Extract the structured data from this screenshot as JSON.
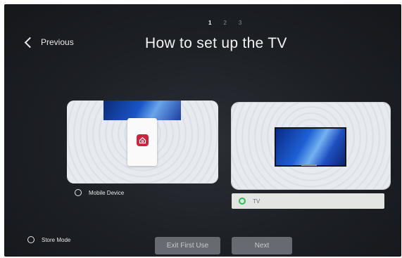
{
  "steps": [
    "1",
    "2",
    "3"
  ],
  "header": {
    "previous_label": "Previous",
    "title": "How to set up the TV"
  },
  "options": {
    "mobile": {
      "label": "Mobile Device"
    },
    "tv": {
      "label": "TV"
    },
    "store_mode": {
      "label": "Store Mode"
    }
  },
  "buttons": {
    "exit": "Exit First Use",
    "next": "Next"
  },
  "icons": {
    "previous": "chevron-left-icon",
    "app": "home-app-icon"
  },
  "colors": {
    "accent_selected": "#2fbd56",
    "app_icon": "#c8263f"
  }
}
